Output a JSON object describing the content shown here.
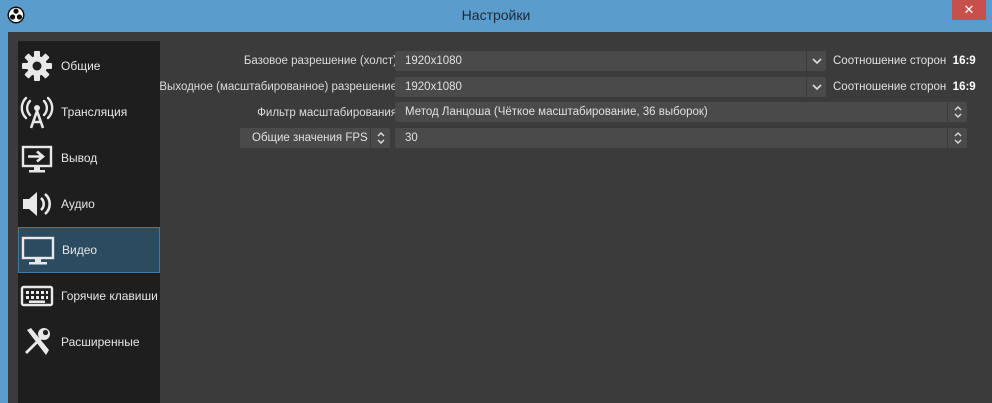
{
  "window": {
    "title": "Настройки",
    "close_label": "✕"
  },
  "sidebar": {
    "items": [
      {
        "label": "Общие",
        "icon": "gear-icon"
      },
      {
        "label": "Трансляция",
        "icon": "broadcast-icon"
      },
      {
        "label": "Вывод",
        "icon": "output-icon"
      },
      {
        "label": "Аудио",
        "icon": "speaker-icon"
      },
      {
        "label": "Видео",
        "icon": "monitor-icon",
        "active": true
      },
      {
        "label": "Горячие клавиши",
        "icon": "keyboard-icon"
      },
      {
        "label": "Расширенные",
        "icon": "tools-icon"
      }
    ]
  },
  "video": {
    "base_resolution": {
      "label": "Базовое разрешение (холст)",
      "value": "1920x1080",
      "ratio_label": "Соотношение сторон",
      "ratio_value": "16:9"
    },
    "output_resolution": {
      "label": "Выходное (масштабированное) разрешение",
      "value": "1920x1080",
      "ratio_label": "Соотношение сторон",
      "ratio_value": "16:9"
    },
    "scale_filter": {
      "label": "Фильтр масштабирования",
      "value": "Метод Ланцоша (Чёткое масштабирование, 36 выборок)"
    },
    "fps": {
      "type_value": "Общие значения FPS",
      "value": "30"
    }
  },
  "colors": {
    "titlebar": "#5a9ccc",
    "panel": "#3b3b3b",
    "sidebar": "#1e1e1e",
    "active": "#2b4b60",
    "close": "#c7504a"
  }
}
